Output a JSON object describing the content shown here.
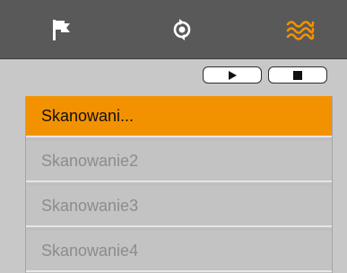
{
  "colors": {
    "tabbar_bg": "#595959",
    "icon_default": "#ffffff",
    "icon_active": "#f39200",
    "selected_row_bg": "#f39200",
    "row_bg": "#c3c3c3",
    "row_text": "#8c8c8c",
    "selected_row_text": "#111111"
  },
  "tabs": [
    {
      "icon": "flag-icon",
      "active": false
    },
    {
      "icon": "rotate-target-icon",
      "active": false
    },
    {
      "icon": "wave-scan-icon",
      "active": true
    }
  ],
  "toolbar": {
    "play_icon": "play-icon",
    "stop_icon": "stop-icon"
  },
  "scan_list": {
    "items": [
      {
        "label": "Skanowani...",
        "selected": true
      },
      {
        "label": "Skanowanie2",
        "selected": false
      },
      {
        "label": "Skanowanie3",
        "selected": false
      },
      {
        "label": "Skanowanie4",
        "selected": false
      }
    ]
  }
}
